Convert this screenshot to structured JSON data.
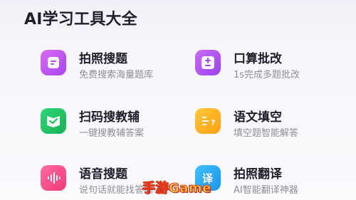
{
  "title": "AI学习工具大全",
  "tools": [
    {
      "name": "拍照搜题",
      "desc": "免费搜索海量题库",
      "icon": "photo-search-icon",
      "color": "#c553f0"
    },
    {
      "name": "口算批改",
      "desc": "1s完成多题批改",
      "icon": "calculator-icon",
      "color": "#b64ff0"
    },
    {
      "name": "扫码搜教辅",
      "desc": "一键搜教辅答案",
      "icon": "scan-book-icon",
      "color": "#24c465"
    },
    {
      "name": "语文填空",
      "desc": "填空题智能解答",
      "icon": "fill-blank-icon",
      "color": "#ffb21e"
    },
    {
      "name": "语音搜题",
      "desc": "说句话就能找答案",
      "icon": "voice-wave-icon",
      "color": "#ff4f8a"
    },
    {
      "name": "拍照翻译",
      "desc": "AI智能翻译神器",
      "icon": "translate-icon",
      "color": "#23a9f5"
    }
  ],
  "watermark": "手游Game"
}
